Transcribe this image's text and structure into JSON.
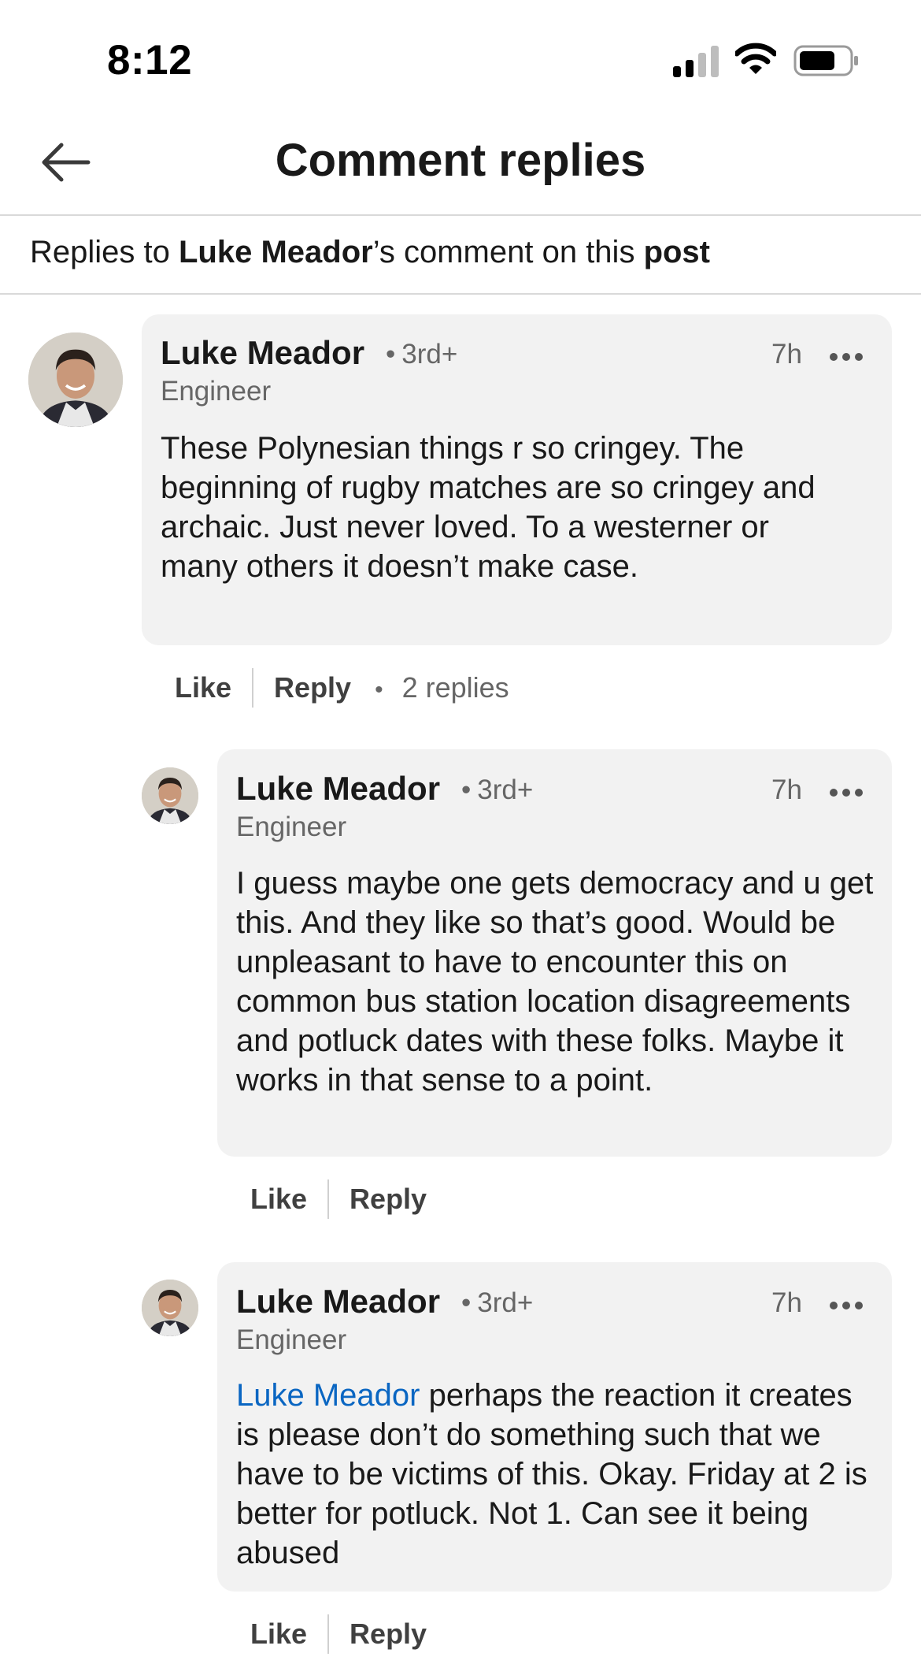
{
  "status_bar": {
    "time": "8:12",
    "icons": [
      "signal-icon",
      "wifi-icon",
      "battery-icon"
    ]
  },
  "header": {
    "title": "Comment replies",
    "back_icon": "back-arrow-icon"
  },
  "context": {
    "prefix": "Replies to ",
    "author": "Luke Meador",
    "middle": "’s comment on this ",
    "post_link": "post"
  },
  "colors": {
    "mention": "#0a66c2",
    "bubble": "#f2f2f2",
    "secondary_text": "#666666"
  },
  "main_comment": {
    "name": "Luke Meador",
    "degree": "3rd+",
    "title": "Engineer",
    "time": "7h",
    "text": "These Polynesian things r so cringey.  The beginning of rugby matches are so cringey and archaic.  Just never loved.  To a westerner or many others it doesn’t make case.",
    "like_label": "Like",
    "reply_label": "Reply",
    "reply_count": "2 replies"
  },
  "replies": [
    {
      "name": "Luke Meador",
      "degree": "3rd+",
      "title": "Engineer",
      "time": "7h",
      "text": "I guess maybe one gets democracy and u get this.  And they like so that’s good.  Would be unpleasant to have to encounter this on common bus station location disagreements and potluck dates with these folks.  Maybe it works in that sense to a point.",
      "like_label": "Like",
      "reply_label": "Reply"
    },
    {
      "name": "Luke Meador",
      "degree": "3rd+",
      "title": "Engineer",
      "time": "7h",
      "mention": "Luke Meador",
      "text": " perhaps the reaction it creates is please don’t do something such that we have to be victims of this.  Okay.  Friday at 2 is better for potluck.  Not 1.  Can see it being abused",
      "like_label": "Like",
      "reply_label": "Reply"
    }
  ]
}
